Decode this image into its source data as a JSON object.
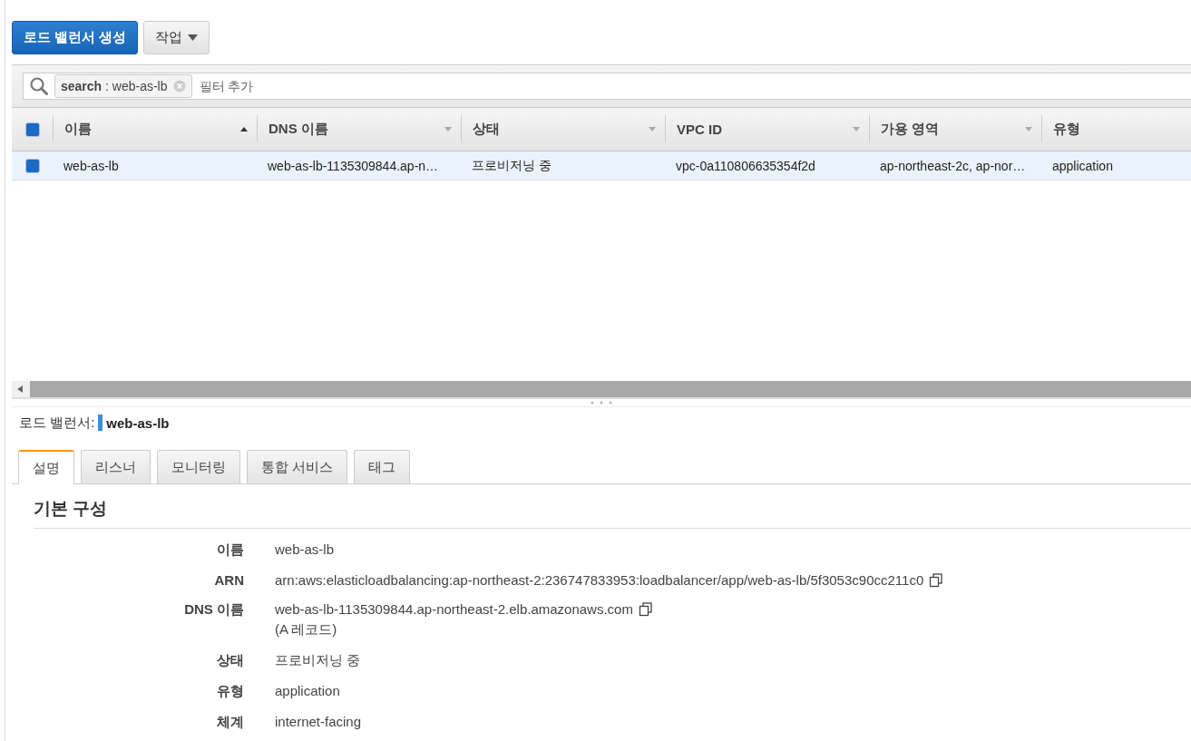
{
  "toolbar": {
    "create_button": "로드 밸런서 생성",
    "actions_button": "작업"
  },
  "filter": {
    "token_key": "search",
    "token_value": " : web-as-lb",
    "placeholder": "필터 추가"
  },
  "table": {
    "all_checked": true,
    "columns": [
      {
        "label": "이름",
        "sorted": true
      },
      {
        "label": "DNS 이름",
        "sorted": false
      },
      {
        "label": "상태",
        "sorted": false
      },
      {
        "label": "VPC ID",
        "sorted": false
      },
      {
        "label": "가용 영역",
        "sorted": false
      },
      {
        "label": "유형"
      }
    ],
    "rows": [
      {
        "selected": true,
        "cells": [
          "web-as-lb",
          "web-as-lb-1135309844.ap-n…",
          "프로비저닝 중",
          "vpc-0a110806635354f2d",
          "ap-northeast-2c, ap-nor…",
          "application"
        ]
      }
    ]
  },
  "detail": {
    "label": "로드 밸런서:",
    "name": "web-as-lb",
    "tabs": [
      {
        "label": "설명",
        "selected": true
      },
      {
        "label": "리스너",
        "selected": false
      },
      {
        "label": "모니터링",
        "selected": false
      },
      {
        "label": "통합 서비스",
        "selected": false
      },
      {
        "label": "태그",
        "selected": false
      }
    ],
    "section_title": "기본 구성",
    "fields": [
      {
        "label": "이름",
        "value": "web-as-lb",
        "copyable": false
      },
      {
        "label": "ARN",
        "value": "arn:aws:elasticloadbalancing:ap-northeast-2:236747833953:loadbalancer/app/web-as-lb/5f3053c90cc211c0",
        "copyable": true
      },
      {
        "label": "DNS 이름",
        "value": "web-as-lb-1135309844.ap-northeast-2.elb.amazonaws.com",
        "copyable": true,
        "note": "(A 레코드)"
      },
      {
        "label": "상태",
        "value": "프로비저닝 중",
        "copyable": false
      },
      {
        "label": "유형",
        "value": "application",
        "copyable": false
      },
      {
        "label": "체계",
        "value": "internet-facing",
        "copyable": false
      }
    ]
  }
}
